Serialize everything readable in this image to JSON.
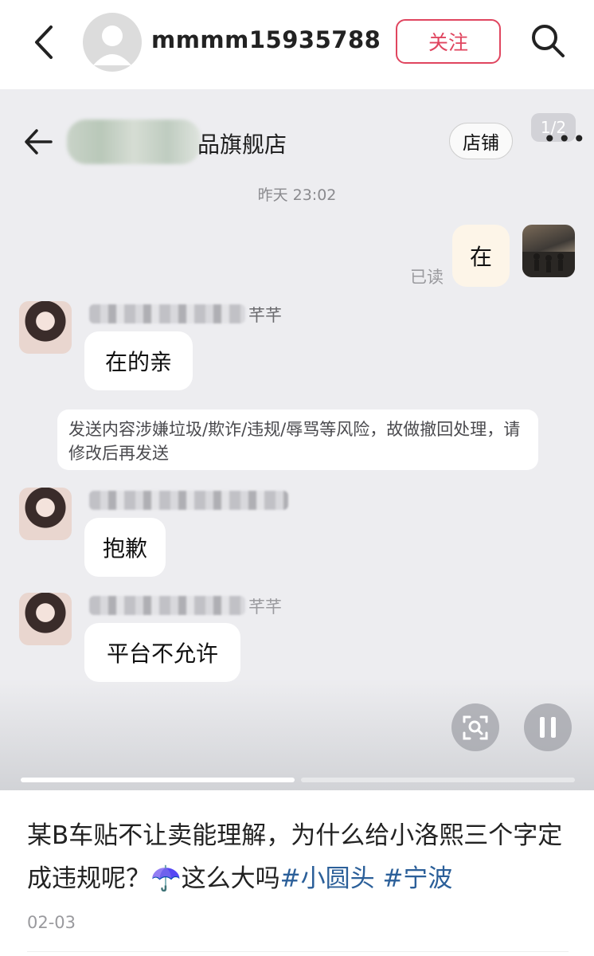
{
  "header": {
    "username": "mmmm15935788",
    "follow_label": "关注"
  },
  "chat": {
    "store_name": "品旗舰店",
    "store_button": "店铺",
    "page_counter": "1/2",
    "timestamp": "昨天 23:02",
    "my_message": "在",
    "read_status": "已读",
    "agent_name_tail": "芊芊",
    "messages": [
      "在的亲",
      "抱歉",
      "平台不允许"
    ],
    "system_notice": "发送内容涉嫌垃圾/欺诈/违规/辱骂等风险，故做撤回处理，请修改后再发送"
  },
  "post": {
    "caption_text": "某B车贴不让卖能理解，为什么给小洛熙三个字定成违规呢？",
    "emoji": "☂️",
    "caption_tail": "这么大吗",
    "tags": [
      "#小圆头",
      "#宁波"
    ],
    "date": "02-03"
  },
  "media_progress": {
    "segments": 2,
    "current": 1
  },
  "colors": {
    "accent": "#e0455f",
    "tag_blue": "#2b5f99",
    "chat_bg": "#ededf0"
  },
  "icons": {
    "back": "chevron-left-icon",
    "search": "search-icon",
    "chat_back": "arrow-left-icon",
    "more": "more-dots-icon",
    "lens": "scan-lens-icon",
    "pause": "pause-icon"
  }
}
